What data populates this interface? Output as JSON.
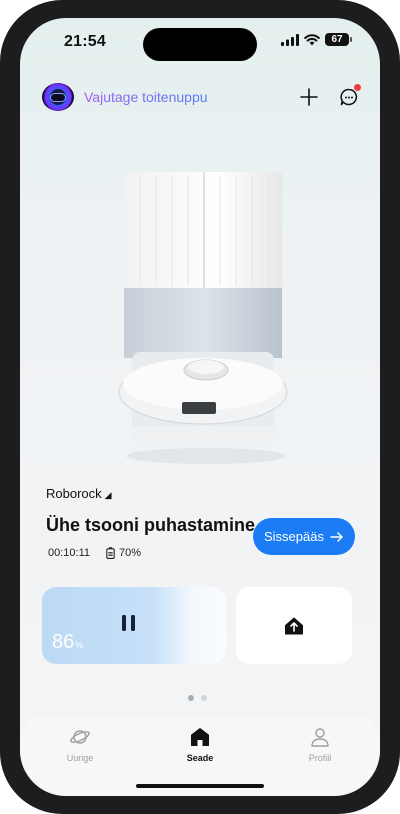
{
  "status_bar": {
    "time": "21:54",
    "battery": "67"
  },
  "header": {
    "device_prompt": "Vajutage toitenuppu",
    "icons": [
      "plus-icon",
      "message-icon"
    ],
    "has_notification": true
  },
  "device": {
    "brand": "Roborock",
    "mode_title": "Ühe tsooni puhastamine",
    "elapsed": "00:10:11",
    "battery_level": "70%",
    "entry_button": "Sissepääs"
  },
  "cards": {
    "main": {
      "battery_percent": "86",
      "percent_sign": "%",
      "icon": "pause-icon"
    },
    "secondary": {
      "icon": "dock-home-icon"
    }
  },
  "pager": {
    "count": 2,
    "active_index": 0
  },
  "tabs": [
    {
      "label": "Uurige",
      "icon": "planet-icon",
      "active": false
    },
    {
      "label": "Seade",
      "icon": "home-icon",
      "active": true
    },
    {
      "label": "Profiil",
      "icon": "person-icon",
      "active": false
    }
  ],
  "colors": {
    "accent": "#1c7cf3",
    "notification": "#f23c3c",
    "tab_inactive": "#9aa0a6",
    "tab_active": "#111111"
  }
}
